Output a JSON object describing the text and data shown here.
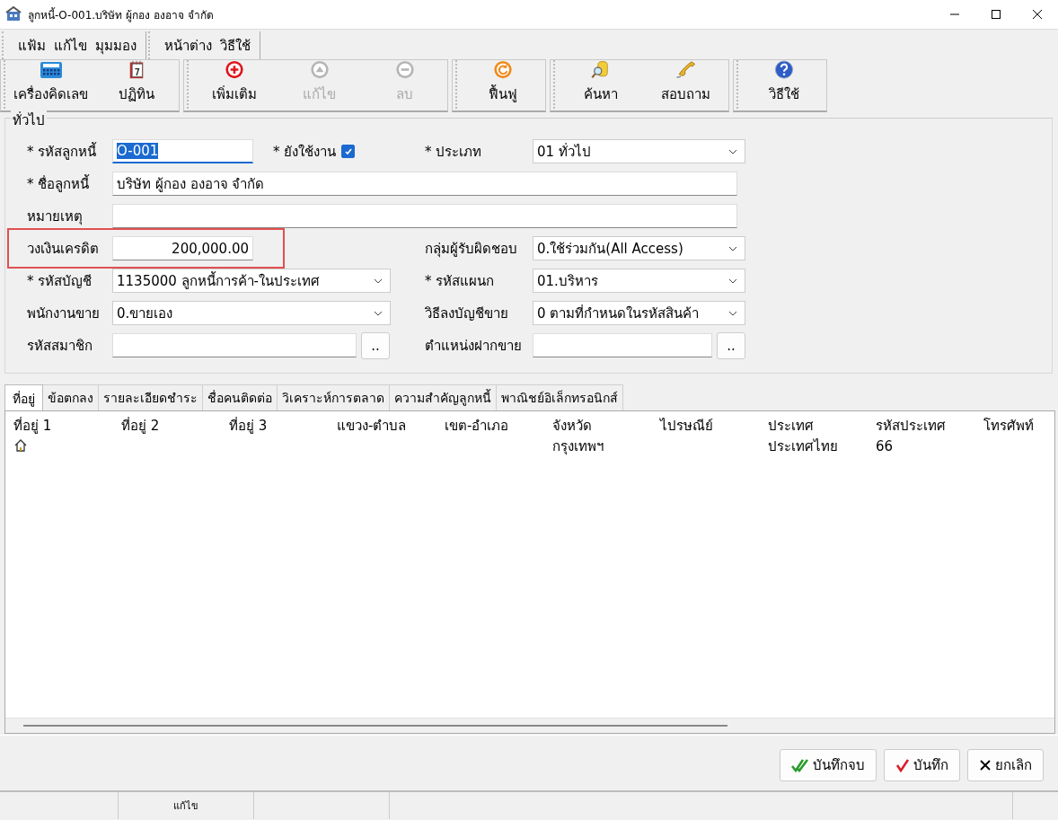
{
  "window": {
    "title": "ลูกหนี้-O-001.บริษัท ผู้กอง องอาจ จำกัด"
  },
  "menu_groups": [
    {
      "items": [
        "แฟ้ม",
        "แก้ไข",
        "มุมมอง"
      ]
    },
    {
      "items": [
        "หน้าต่าง",
        "วิธีใช้"
      ]
    }
  ],
  "toolbar_groups": [
    {
      "buttons": [
        {
          "label": "เครื่องคิดเลข",
          "kind": "calculator",
          "disabled": false
        },
        {
          "label": "ปฏิทิน",
          "kind": "calendar",
          "disabled": false
        }
      ]
    },
    {
      "buttons": [
        {
          "label": "เพิ่มเติม",
          "kind": "add",
          "disabled": false
        },
        {
          "label": "แก้ไข",
          "kind": "edit",
          "disabled": true
        },
        {
          "label": "ลบ",
          "kind": "delete",
          "disabled": true
        }
      ]
    },
    {
      "buttons": [
        {
          "label": "ฟื้นฟู",
          "kind": "refresh",
          "disabled": false
        }
      ]
    },
    {
      "buttons": [
        {
          "label": "ค้นหา",
          "kind": "search",
          "disabled": false
        },
        {
          "label": "สอบถาม",
          "kind": "phone",
          "disabled": false
        }
      ]
    },
    {
      "buttons": [
        {
          "label": "วิธีใช้",
          "kind": "help",
          "disabled": false
        }
      ]
    }
  ],
  "general": {
    "title": "ทั่วไป",
    "rows": [
      {
        "highlighted": false,
        "left": [
          {
            "kind": "text",
            "label": "* รหัสลูกหนี้",
            "value": "O-001",
            "focused": true
          },
          {
            "kind": "checkbox",
            "label": "* ยังใช้งาน",
            "checked": true
          }
        ],
        "right": [
          {
            "kind": "select",
            "label": "* ประเภท",
            "value": "01 ทั่วไป"
          }
        ]
      },
      {
        "highlighted": false,
        "left": [
          {
            "kind": "text",
            "label": "* ชื่อลูกหนี้",
            "value": "บริษัท ผู้กอง องอาจ จำกัด",
            "focused": false
          }
        ],
        "right": []
      },
      {
        "highlighted": false,
        "left": [
          {
            "kind": "text",
            "label": "หมายเหตุ",
            "focused": false
          }
        ],
        "right": []
      },
      {
        "highlighted": true,
        "left": [
          {
            "kind": "number",
            "label": "วงเงินเครดิต",
            "value": "200,000.00"
          }
        ],
        "right": [
          {
            "kind": "select",
            "label": "กลุ่มผู้รับผิดชอบ",
            "value": "0.ใช้ร่วมกัน(All Access)"
          }
        ]
      },
      {
        "highlighted": false,
        "left": [
          {
            "kind": "select",
            "label": "* รหัสบัญชี",
            "value": "1135000 ลูกหนี้การค้า-ในประเทศ"
          }
        ],
        "right": [
          {
            "kind": "select",
            "label": "* รหัสแผนก",
            "value": "01.บริหาร"
          }
        ]
      },
      {
        "highlighted": false,
        "left": [
          {
            "kind": "select",
            "label": "พนักงานขาย",
            "value": "0.ขายเอง"
          }
        ],
        "right": [
          {
            "kind": "select",
            "label": "วิธีลงบัญชีขาย",
            "value": "0 ตามที่กำหนดในรหัสสินค้า"
          }
        ]
      },
      {
        "highlighted": false,
        "left": [
          {
            "kind": "browse",
            "label": "รหัสสมาชิก",
            "button": ".."
          }
        ],
        "right": [
          {
            "kind": "browse",
            "label": "ตำแหน่งฝากขาย",
            "button": ".."
          }
        ]
      }
    ]
  },
  "tabs": [
    {
      "label": "ที่อยู่",
      "selected": true
    },
    {
      "label": "ข้อตกลง",
      "selected": false
    },
    {
      "label": "รายละเอียดชำระ",
      "selected": false
    },
    {
      "label": "ชื่อคนติดต่อ",
      "selected": false
    },
    {
      "label": "วิเคราะห์การตลาด",
      "selected": false
    },
    {
      "label": "ความสำคัญลูกหนี้",
      "selected": false
    },
    {
      "label": "พาณิชย์อิเล็กทรอนิกส์",
      "selected": false
    }
  ],
  "table": {
    "columns": [
      "ที่อยู่ 1",
      "ที่อยู่ 2",
      "ที่อยู่ 3",
      "แขวง-ตำบล",
      "เขต-อำเภอ",
      "จังหวัด",
      "ไปรษณีย์",
      "ประเทศ",
      "รหัสประเทศ",
      "โทรศัพท์"
    ],
    "rows": [
      {
        "cells": [
          "",
          "",
          "",
          "",
          "",
          "กรุงเทพฯ",
          "",
          "ประเทศไทย",
          "66",
          ""
        ]
      }
    ]
  },
  "buttons": [
    {
      "label": "บันทึกจบ",
      "kind": "save_close"
    },
    {
      "label": "บันทึก",
      "kind": "save"
    },
    {
      "label": "ยกเลิก",
      "kind": "cancel"
    }
  ],
  "status_bar": {
    "mode": "แก้ไข"
  }
}
